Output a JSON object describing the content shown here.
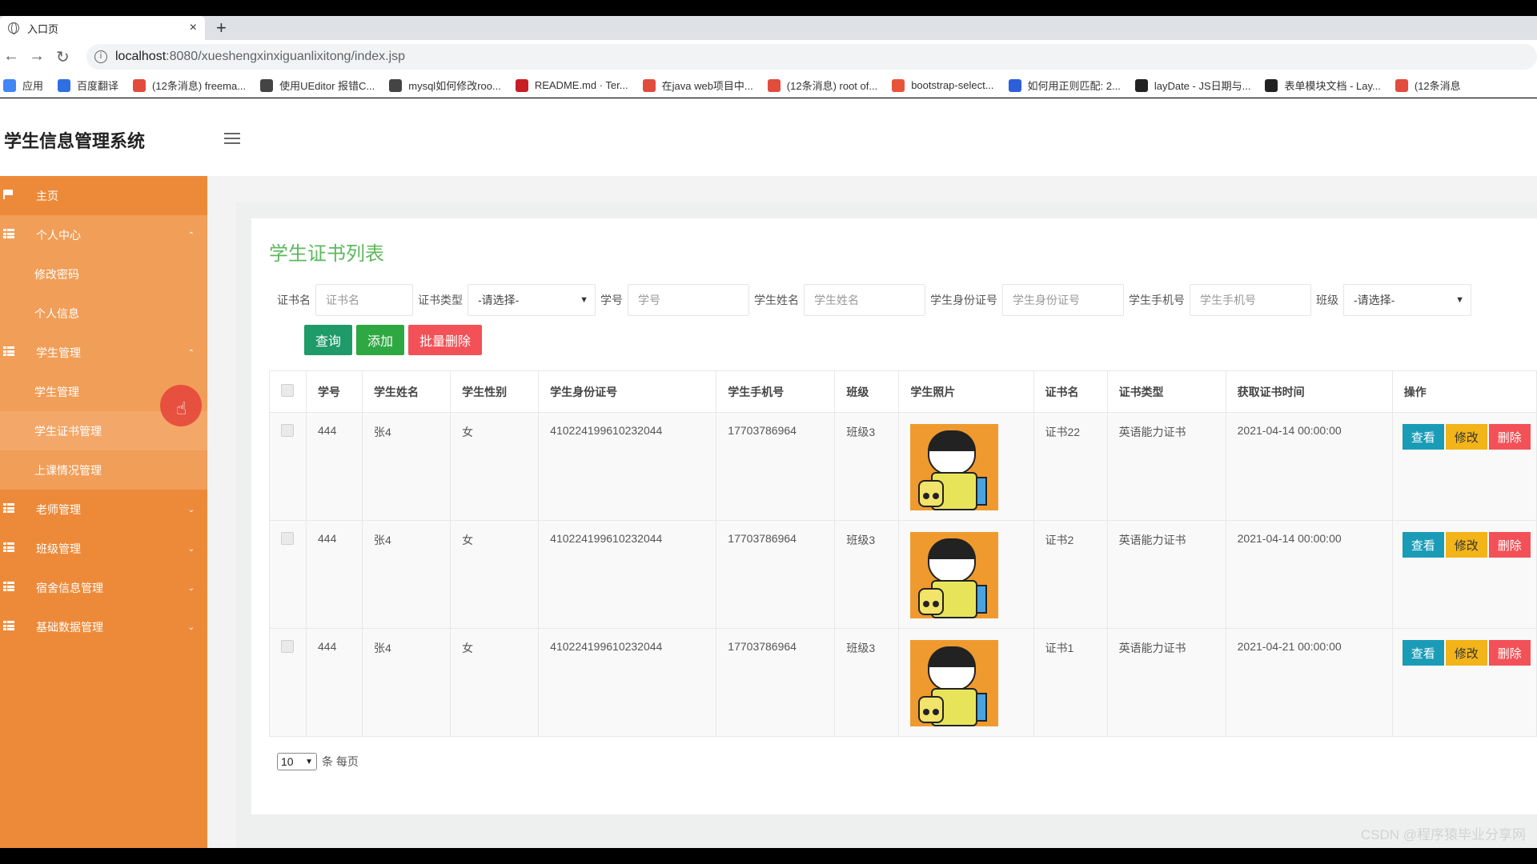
{
  "browser": {
    "tab_title": "入口页",
    "tab_close": "×",
    "new_tab": "+",
    "url_host": "localhost",
    "url_rest": ":8080/xueshengxinxiguanlixitong/index.jsp",
    "bookmarks": [
      {
        "label": "应用",
        "color": "#4285f4"
      },
      {
        "label": "百度翻译",
        "color": "#2f6fe4"
      },
      {
        "label": "(12条消息) freema...",
        "color": "#e14c3d"
      },
      {
        "label": "使用UEditor 报错C...",
        "color": "#444444"
      },
      {
        "label": "mysql如何修改roo...",
        "color": "#444444"
      },
      {
        "label": "README.md · Ter...",
        "color": "#c71d23"
      },
      {
        "label": "在java web项目中...",
        "color": "#e14c3d"
      },
      {
        "label": "(12条消息) root of...",
        "color": "#e14c3d"
      },
      {
        "label": "bootstrap-select...",
        "color": "#e8543a"
      },
      {
        "label": "如何用正则匹配: 2...",
        "color": "#2f5fd8"
      },
      {
        "label": "layDate - JS日期与...",
        "color": "#222222"
      },
      {
        "label": "表单模块文档 - Lay...",
        "color": "#222222"
      },
      {
        "label": "(12条消息",
        "color": "#e14c3d"
      }
    ]
  },
  "app": {
    "title": "学生信息管理系统"
  },
  "sidebar": {
    "items": [
      {
        "label": "主页",
        "icon": "flag-icon",
        "type": "item"
      },
      {
        "label": "个人中心",
        "icon": "grid-icon",
        "type": "parent",
        "caret": "⌃",
        "open": true
      },
      {
        "label": "修改密码",
        "type": "sub"
      },
      {
        "label": "个人信息",
        "type": "sub"
      },
      {
        "label": "学生管理",
        "icon": "grid-icon",
        "type": "parent",
        "caret": "⌃",
        "open": true
      },
      {
        "label": "学生管理",
        "type": "sub"
      },
      {
        "label": "学生证书管理",
        "type": "sub",
        "active": true
      },
      {
        "label": "上课情况管理",
        "type": "sub"
      },
      {
        "label": "老师管理",
        "icon": "grid-icon",
        "type": "parent",
        "caret": "⌄"
      },
      {
        "label": "班级管理",
        "icon": "grid-icon",
        "type": "parent",
        "caret": "⌄"
      },
      {
        "label": "宿舍信息管理",
        "icon": "grid-icon",
        "type": "parent",
        "caret": "⌄"
      },
      {
        "label": "基础数据管理",
        "icon": "grid-icon",
        "type": "parent",
        "caret": "⌄"
      }
    ]
  },
  "main": {
    "title": "学生证书列表",
    "filters": {
      "cert_name_label": "证书名",
      "cert_name_placeholder": "证书名",
      "cert_type_label": "证书类型",
      "cert_type_value": "-请选择-",
      "stu_no_label": "学号",
      "stu_no_placeholder": "学号",
      "stu_name_label": "学生姓名",
      "stu_name_placeholder": "学生姓名",
      "id_label": "学生身份证号",
      "id_placeholder": "学生身份证号",
      "phone_label": "学生手机号",
      "phone_placeholder": "学生手机号",
      "class_label": "班级",
      "class_value": "-请选择-"
    },
    "buttons": {
      "query": "查询",
      "add": "添加",
      "batch_delete": "批量删除"
    },
    "table": {
      "headers": [
        "学号",
        "学生姓名",
        "学生性别",
        "学生身份证号",
        "学生手机号",
        "班级",
        "学生照片",
        "证书名",
        "证书类型",
        "获取证书时间",
        "操作"
      ],
      "rows": [
        {
          "no": "444",
          "name": "张4",
          "gender": "女",
          "id": "410224199610232044",
          "phone": "17703786964",
          "class": "班级3",
          "cert": "证书22",
          "type": "英语能力证书",
          "time": "2021-04-14 00:00:00"
        },
        {
          "no": "444",
          "name": "张4",
          "gender": "女",
          "id": "410224199610232044",
          "phone": "17703786964",
          "class": "班级3",
          "cert": "证书2",
          "type": "英语能力证书",
          "time": "2021-04-14 00:00:00"
        },
        {
          "no": "444",
          "name": "张4",
          "gender": "女",
          "id": "410224199610232044",
          "phone": "17703786964",
          "class": "班级3",
          "cert": "证书1",
          "type": "英语能力证书",
          "time": "2021-04-21 00:00:00"
        }
      ],
      "actions": {
        "view": "查看",
        "edit": "修改",
        "delete": "删除"
      }
    },
    "pager": {
      "page_size": "10",
      "suffix": "条 每页"
    }
  },
  "watermark": "CSDN @程序猿毕业分享网"
}
